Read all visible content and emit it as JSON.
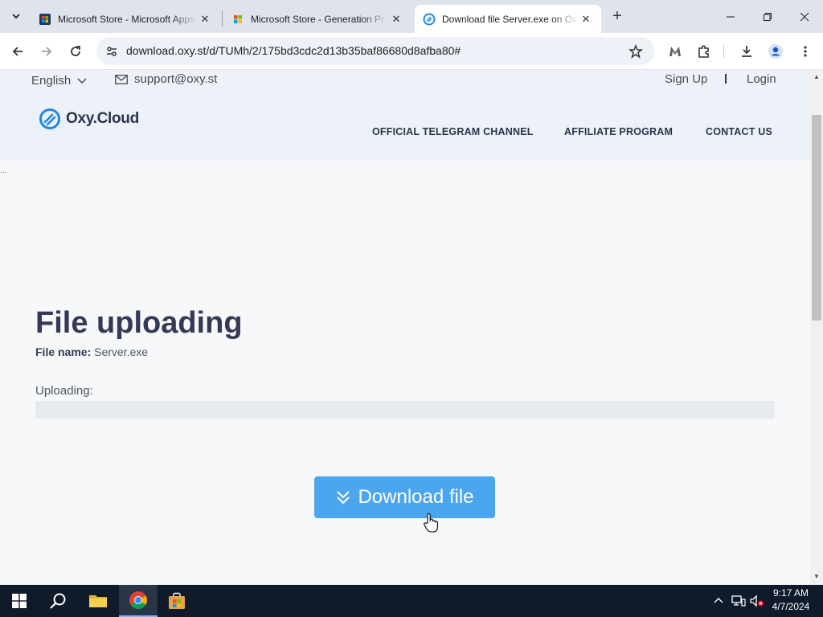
{
  "browser": {
    "tabs": [
      {
        "title": "Microsoft Store - Microsoft Apps",
        "active": false
      },
      {
        "title": "Microsoft Store - Generation Pr",
        "active": false
      },
      {
        "title": "Download file Server.exe on Oxy.Cloud",
        "active": true
      }
    ],
    "url": "download.oxy.st/d/TUMh/2/175bd3cdc2d13b35baf86680d8afba80#"
  },
  "page": {
    "language": "English",
    "support_email": "support@oxy.st",
    "sign_up": "Sign Up",
    "login": "Login",
    "logo_text": "Oxy.Cloud",
    "nav": [
      "OFFICIAL TELEGRAM CHANNEL",
      "AFFILIATE PROGRAM",
      "CONTACT US"
    ],
    "heading": "File uploading",
    "file_name_label": "File name:",
    "file_name_value": "Server.exe",
    "uploading_label": "Uploading:",
    "upload_progress": 0,
    "download_button": "Download file",
    "edge_text": "..."
  },
  "taskbar": {
    "time": "9:17 AM",
    "date": "4/7/2024"
  },
  "colors": {
    "accent": "#4aa6f0",
    "heading": "#343a55",
    "taskbar": "#0f1a2a"
  }
}
